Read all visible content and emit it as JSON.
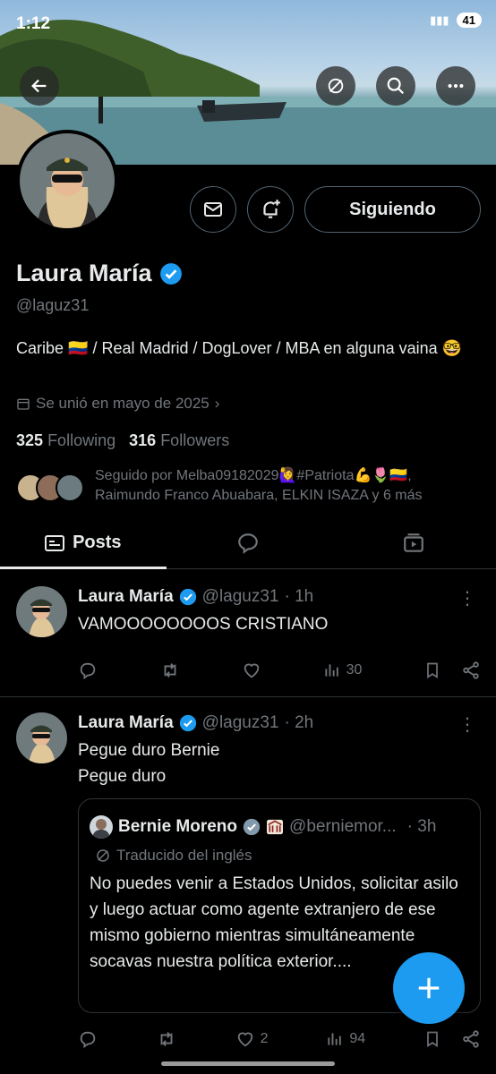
{
  "status": {
    "time": "1:12",
    "battery": "41"
  },
  "banner": {
    "back_icon": "arrow-left-icon",
    "hide_icon": "eye-off-icon",
    "search_icon": "search-icon",
    "more_icon": "more-icon"
  },
  "profile": {
    "name": "Laura María",
    "handle": "@laguz31",
    "bio": "Caribe 🇨🇴 / Real Madrid / DogLover / MBA en alguna vaina 🤓",
    "joined": "Se unió en mayo de 2025",
    "following_count": "325",
    "following_label": "Following",
    "followers_count": "316",
    "followers_label": "Followers",
    "followed_by": "Seguido por Melba09182029🙋‍♀️#Patriota💪🌷🇨🇴, Raimundo Franco Abuabara, ELKIN ISAZA y 6 más",
    "follow_button": "Siguiendo"
  },
  "tabs": [
    {
      "label": "Posts",
      "icon": "posts-icon",
      "active": true
    },
    {
      "label": "",
      "icon": "replies-icon",
      "active": false
    },
    {
      "label": "",
      "icon": "media-icon",
      "active": false
    }
  ],
  "tweets": [
    {
      "name": "Laura María",
      "handle": "@laguz31",
      "time": "· 1h",
      "text": "VAMOOOOOOOOS CRISTIANO",
      "replies": "",
      "retweets": "",
      "likes": "",
      "views": "30"
    },
    {
      "name": "Laura María",
      "handle": "@laguz31",
      "time": "· 2h",
      "text_line1": "Pegue duro Bernie",
      "text_line2": "Pegue duro",
      "quote": {
        "name": "Bernie Moreno",
        "handle": "@berniemor...",
        "time": "· 3h",
        "translated": "Traducido del inglés",
        "text": "No puedes venir a Estados Unidos, solicitar asilo y luego actuar como agente extranjero de ese mismo gobierno mientras simultáneamente socavas nuestra política exterior...."
      },
      "replies": "",
      "retweets": "",
      "likes": "2",
      "views": "94"
    }
  ],
  "colors": {
    "accent": "#1d9bf0",
    "muted": "#71767b",
    "border": "#2f3336",
    "text": "#e7e9ea"
  }
}
